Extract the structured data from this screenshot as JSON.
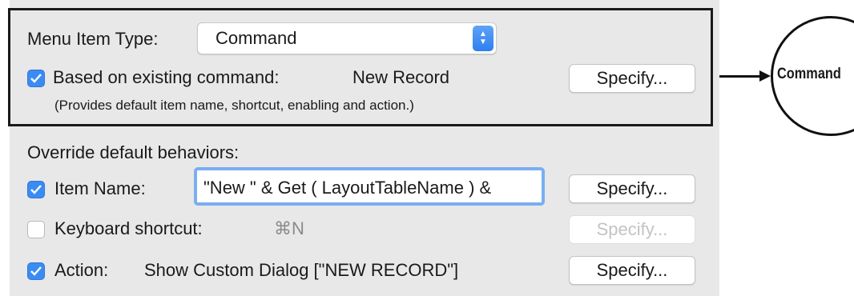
{
  "menu_item_type": {
    "label": "Menu Item Type:",
    "value": "Command",
    "stepper_icon": "up-down-chevrons"
  },
  "based_on": {
    "checked": true,
    "label": "Based on existing command:",
    "value": "New Record",
    "note": "(Provides default item name, shortcut, enabling and action.)",
    "button": "Specify..."
  },
  "override": {
    "heading": "Override default behaviors:",
    "item_name": {
      "checked": true,
      "label": "Item Name:",
      "value": "\"New \" & Get ( LayoutTableName ) &",
      "button": "Specify..."
    },
    "keyboard_shortcut": {
      "checked": false,
      "label": "Keyboard shortcut:",
      "value": "⌘N",
      "button": "Specify..."
    },
    "action": {
      "checked": true,
      "label": "Action:",
      "value": "Show Custom Dialog [\"NEW RECORD\"]",
      "button": "Specify..."
    }
  },
  "callout": {
    "label": "Command"
  },
  "colors": {
    "accent": "#3b8cf2",
    "panel": "#e8e8e8",
    "focus_ring": "#7aaef0"
  }
}
